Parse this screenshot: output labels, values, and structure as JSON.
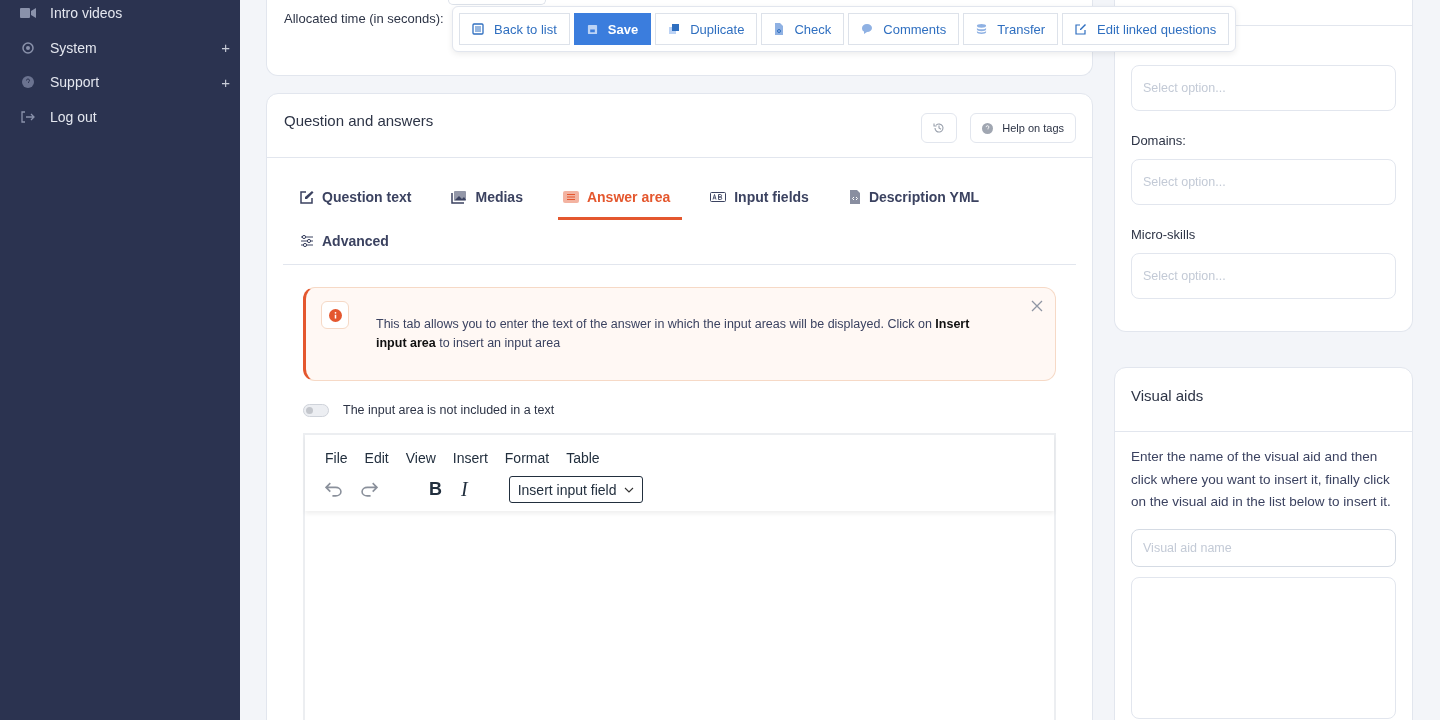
{
  "sidebar": {
    "items": [
      {
        "label": "Intro videos"
      },
      {
        "label": "System",
        "toggle": "+"
      },
      {
        "label": "Support",
        "toggle": "+"
      },
      {
        "label": "Log out"
      }
    ]
  },
  "toolbar": {
    "buttons": [
      {
        "label": "Back to list",
        "kind": "default"
      },
      {
        "label": "Save",
        "kind": "primary"
      },
      {
        "label": "Duplicate",
        "kind": "default"
      },
      {
        "label": "Check",
        "kind": "default"
      },
      {
        "label": "Comments",
        "kind": "default"
      },
      {
        "label": "Transfer",
        "kind": "default"
      },
      {
        "label": "Edit linked questions",
        "kind": "default"
      }
    ]
  },
  "settings_card": {
    "allocated_time_label": "Allocated time (in seconds):"
  },
  "question_card": {
    "title": "Question and answers",
    "help_button": "Help on tags",
    "tabs": [
      {
        "label": "Question text",
        "selected": false
      },
      {
        "label": "Medias",
        "selected": false
      },
      {
        "label": "Answer area",
        "selected": true
      },
      {
        "label": "Input fields",
        "selected": false
      },
      {
        "label": "Description YML",
        "selected": false
      },
      {
        "label": "Advanced",
        "selected": false
      }
    ],
    "alert": {
      "text": "This tab allows you to enter the text of the answer in which the input areas will be displayed. Click on **Insert input area** to insert an input area"
    },
    "toggle": {
      "label": "The input area is not included in a text",
      "on": false
    },
    "editor": {
      "menu": [
        "File",
        "Edit",
        "View",
        "Insert",
        "Format",
        "Table"
      ],
      "bold": "B",
      "italic": "I",
      "insert_dropdown": "Insert input field"
    }
  },
  "classification_card": {
    "fields": [
      {
        "placeholder": "Select option..."
      },
      {
        "label": "Domains:",
        "placeholder": "Select option..."
      },
      {
        "label": "Micro-skills",
        "placeholder": "Select option..."
      }
    ]
  },
  "visual_aids_card": {
    "title": "Visual aids",
    "description": "Enter the name of the visual aid and then click where you want to insert it, finally click on the visual aid in the list below to insert it.",
    "name_placeholder": "Visual aid name"
  }
}
